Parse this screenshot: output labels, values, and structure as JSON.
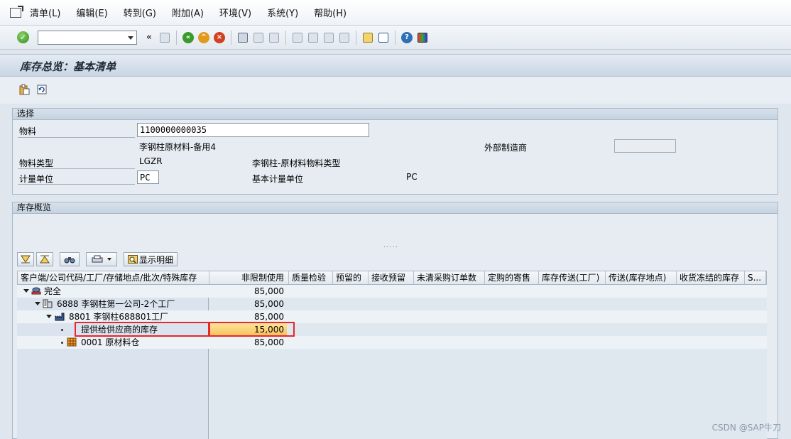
{
  "menubar": {
    "items": [
      "清单(L)",
      "编辑(E)",
      "转到(G)",
      "附加(A)",
      "环境(V)",
      "系统(Y)",
      "帮助(H)"
    ]
  },
  "toolbar": {
    "command_value": "",
    "back_glyph": "«"
  },
  "title": "库存总览：基本清单",
  "selection": {
    "frame_title": "选择",
    "material_label": "物料",
    "material_value": "1100000000035",
    "material_desc": "李钢柱原材料-备用4",
    "external_mfr_label": "外部制造商",
    "external_mfr_value": "",
    "material_type_label": "物料类型",
    "material_type_value": "LGZR",
    "material_type_desc": "李钢柱-原材料物料类型",
    "uom_label": "计量单位",
    "uom_value": "PC",
    "base_uom_label": "基本计量单位",
    "base_uom_value": "PC"
  },
  "overview": {
    "frame_title": "库存概览",
    "show_detail_label": "显示明细",
    "splitter_glyph": "....."
  },
  "grid": {
    "columns": [
      "客户端/公司代码/工厂/存储地点/批次/特殊库存",
      "非限制使用",
      "质量检验",
      "预留的",
      "接收预留",
      "未清采购订单数",
      "定购的寄售",
      "库存传送(工厂)",
      "传送(库存地点)",
      "收货冻结的库存",
      "S..."
    ],
    "rows": [
      {
        "label": "完全",
        "unrestricted": "85,000"
      },
      {
        "label": "6888 李钢柱第一公司-2个工厂",
        "unrestricted": "85,000"
      },
      {
        "label": "8801 李钢柱688801工厂",
        "unrestricted": "85,000"
      },
      {
        "label": "提供给供应商的库存",
        "unrestricted": "15,000"
      },
      {
        "label": "0001 原材料仓",
        "unrestricted": "85,000"
      }
    ]
  },
  "watermark": "CSDN @SAP牛刀",
  "colors": {
    "highlight": "#f6c25a",
    "annotation_box": "#e8262b"
  }
}
